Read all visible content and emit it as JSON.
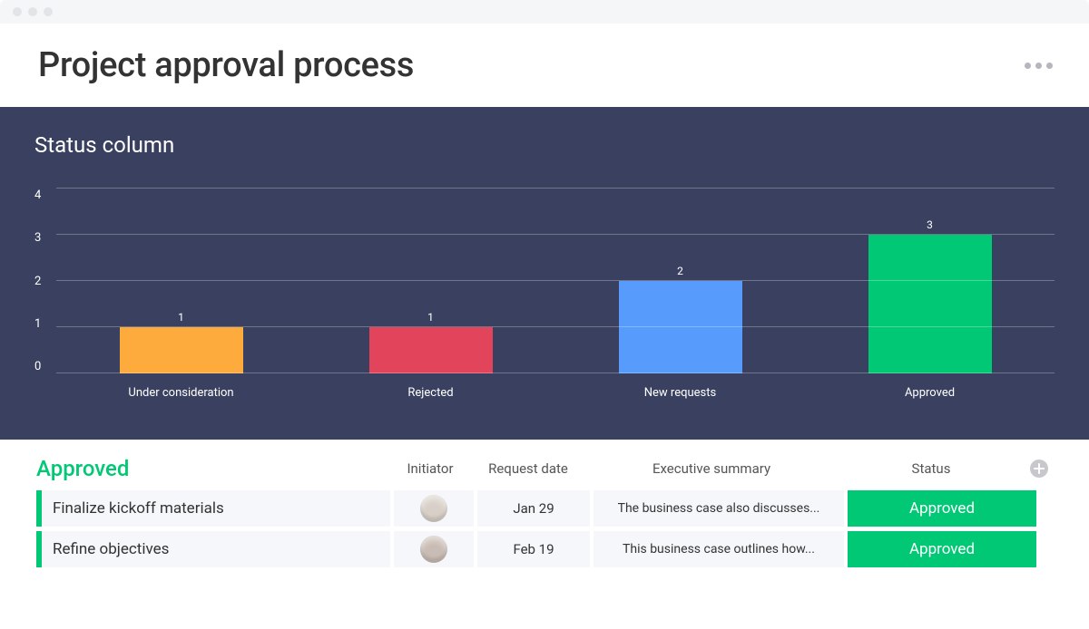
{
  "header": {
    "title": "Project approval process"
  },
  "chart_data": {
    "type": "bar",
    "title": "Status column",
    "categories": [
      "Under consideration",
      "Rejected",
      "New requests",
      "Approved"
    ],
    "values": [
      1,
      1,
      2,
      3
    ],
    "colors": [
      "#fdab3d",
      "#e2445c",
      "#579bfc",
      "#00c875"
    ],
    "ylim": [
      0,
      4
    ],
    "yticks": [
      0,
      1,
      2,
      3,
      4
    ],
    "xlabel": "",
    "ylabel": ""
  },
  "table": {
    "group_title": "Approved",
    "columns": {
      "initiator": "Initiator",
      "request_date": "Request date",
      "executive_summary": "Executive summary",
      "status": "Status"
    },
    "rows": [
      {
        "name": "Finalize kickoff materials",
        "date": "Jan 29",
        "summary": "The business case also discusses...",
        "status": "Approved"
      },
      {
        "name": "Refine objectives",
        "date": "Feb 19",
        "summary": "This business case outlines how...",
        "status": "Approved"
      }
    ],
    "accent_color": "#00c875"
  }
}
